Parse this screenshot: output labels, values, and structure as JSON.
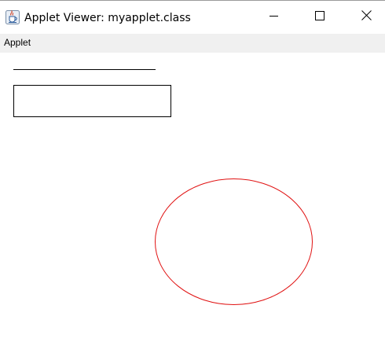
{
  "window": {
    "title": "Applet Viewer: myapplet.class",
    "app_icon": "java-cup-icon",
    "controls": {
      "minimize_icon": "minimize-icon",
      "maximize_icon": "maximize-icon",
      "close_icon": "close-icon"
    }
  },
  "menubar": {
    "items": [
      {
        "label": "Applet"
      }
    ]
  },
  "applet": {
    "shapes": [
      {
        "kind": "line",
        "color": "#000000"
      },
      {
        "kind": "rectangle",
        "color": "#000000",
        "filled": false
      },
      {
        "kind": "oval",
        "color": "#e01010",
        "filled": false
      }
    ]
  }
}
